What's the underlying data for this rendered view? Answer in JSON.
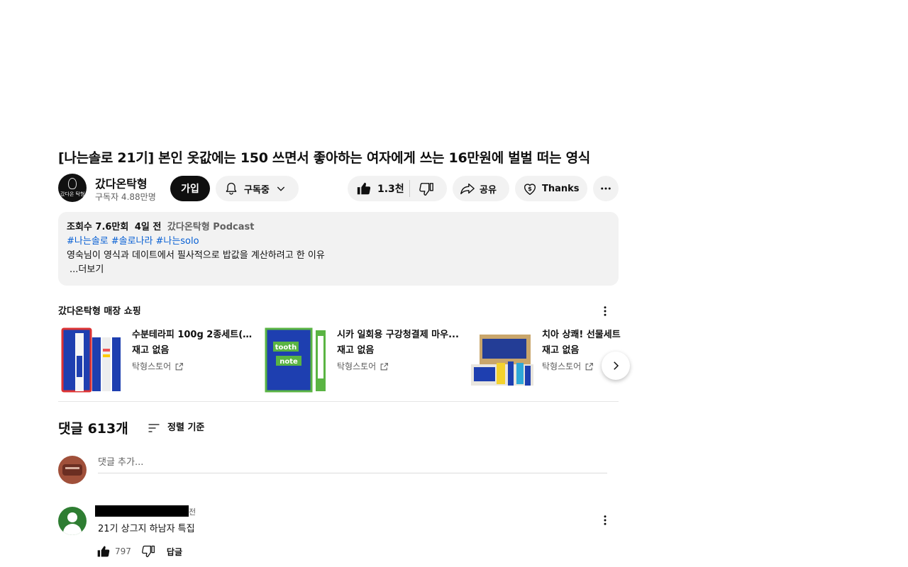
{
  "video": {
    "title": "[나는솔로 21기] 본인 옷값에는 150 쓰면서 좋아하는 여자에게 쓰는 16만원에 벌벌 떠는 영식"
  },
  "channel": {
    "name": "갔다온탁형",
    "subscribers": "구독자 4.88만명",
    "avatar_caption": "갔다온 탁형"
  },
  "actions": {
    "join_label": "가입",
    "subscribed_label": "구독중",
    "like_count": "1.3천",
    "share_label": "공유",
    "thanks_label": "Thanks"
  },
  "description": {
    "views": "조회수 7.6만회",
    "date": "4일 전",
    "podcast": "갔다온탁형 Podcast",
    "hashtags": [
      "#나는솔로",
      "#솔로나라",
      "#나는solo"
    ],
    "text": "영숙님이 영식과 데이트에서 필사적으로 밥값을 계산하려고 한 이유",
    "more_label": "...더보기"
  },
  "shopping": {
    "heading": "갔다온탁형 매장 쇼핑",
    "products": [
      {
        "name": "수분테라피 100g 2종세트(자...",
        "stock": "재고 없음",
        "store": "탁형스토어"
      },
      {
        "name": "시카 일회용 구강청결제 마우...",
        "stock": "재고 없음",
        "store": "탁형스토어"
      },
      {
        "name": "치아 상쾌! 선물세트",
        "stock": "재고 없음",
        "store": "탁형스토어"
      }
    ]
  },
  "comments": {
    "count_label": "댓글 613개",
    "sort_label": "정렬 기준",
    "add_placeholder": "댓글 추가...",
    "items": [
      {
        "time": "전",
        "text": "21기 상그지 하남자 특집",
        "likes": "797",
        "reply_label": "답글"
      }
    ]
  },
  "colors": {
    "hashtag": "#065fd4",
    "pill_bg": "#f2f2f2",
    "join_bg": "#0f0f0f"
  }
}
